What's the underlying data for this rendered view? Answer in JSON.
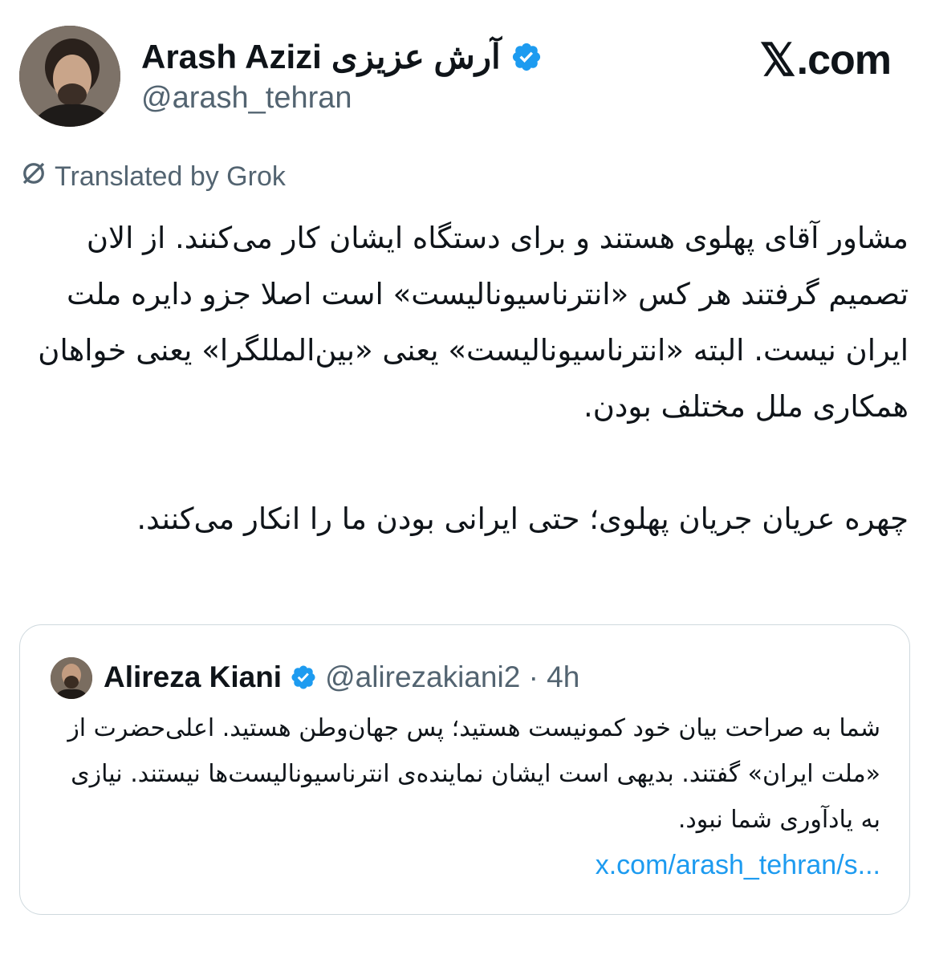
{
  "brand": {
    "x_mark": "𝕏",
    "domain": ".com"
  },
  "author": {
    "name": "Arash Azizi",
    "name_fa": "آرش عزیزی",
    "handle": "@arash_tehran",
    "verified": true
  },
  "translation_notice": "Translated by Grok",
  "tweet": {
    "paragraphs": [
      "مشاور آقای پهلوی هستند و برای دستگاه ایشان کار می‌کنند. از الان تصمیم گرفتند هر کس «انترناسیونالیست» است اصلا جزو دایره ملت ایران نیست. البته «انترناسیونالیست» یعنی «بین‌المللگرا» یعنی خواهان همکاری ملل مختلف بودن.",
      "چهره عریان جریان پهلوی؛ حتی ایرانی بودن ما را انکار می‌کنند."
    ]
  },
  "quoted_tweet": {
    "name": "Alireza Kiani",
    "verified": true,
    "handle_time": "@alirezakiani2 · 4h",
    "text": "شما به صراحت بیان خود کمونیست هستید؛ پس جهان‌وطن هستید. اعلی‌حضرت از «ملت ایران» گفتند. بدیهی است ایشان نماینده‌ی انترناسیونالیست‌ها نیستند. نیازی به یادآوری شما نبود.",
    "link": "x.com/arash_tehran/s..."
  },
  "colors": {
    "text": "#0f1419",
    "secondary": "#536471",
    "link": "#1d9bf0",
    "verified": "#1d9bf0",
    "border": "#cfd9de"
  },
  "icons": {
    "verified": "verified-badge-icon",
    "translate": "no-translate-icon"
  }
}
